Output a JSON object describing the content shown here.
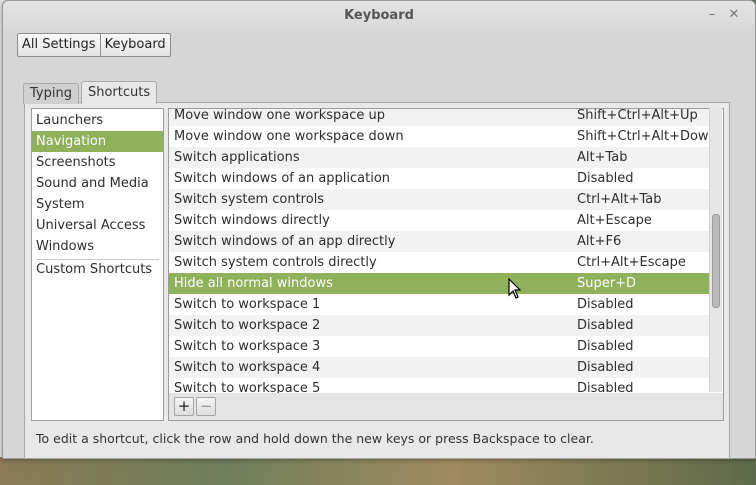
{
  "window": {
    "title": "Keyboard"
  },
  "breadcrumb": [
    "All Settings",
    "Keyboard"
  ],
  "tabs": [
    {
      "label": "Typing",
      "active": false
    },
    {
      "label": "Shortcuts",
      "active": true
    }
  ],
  "categories": {
    "items": [
      "Launchers",
      "Navigation",
      "Screenshots",
      "Sound and Media",
      "System",
      "Universal Access",
      "Windows"
    ],
    "selected": "Navigation",
    "custom": "Custom Shortcuts"
  },
  "shortcuts": [
    {
      "name": "Move window one workspace up",
      "accel": "Shift+Ctrl+Alt+Up"
    },
    {
      "name": "Move window one workspace down",
      "accel": "Shift+Ctrl+Alt+Down"
    },
    {
      "name": "Switch applications",
      "accel": "Alt+Tab"
    },
    {
      "name": "Switch windows of an application",
      "accel": "Disabled"
    },
    {
      "name": "Switch system controls",
      "accel": "Ctrl+Alt+Tab"
    },
    {
      "name": "Switch windows directly",
      "accel": "Alt+Escape"
    },
    {
      "name": "Switch windows of an app directly",
      "accel": "Alt+F6"
    },
    {
      "name": "Switch system controls directly",
      "accel": "Ctrl+Alt+Escape"
    },
    {
      "name": "Hide all normal windows",
      "accel": "Super+D",
      "selected": true
    },
    {
      "name": "Switch to workspace 1",
      "accel": "Disabled"
    },
    {
      "name": "Switch to workspace 2",
      "accel": "Disabled"
    },
    {
      "name": "Switch to workspace 3",
      "accel": "Disabled"
    },
    {
      "name": "Switch to workspace 4",
      "accel": "Disabled"
    },
    {
      "name": "Switch to workspace 5",
      "accel": "Disabled"
    }
  ],
  "toolbar": {
    "add_label": "+",
    "remove_label": "−"
  },
  "hint": "To edit a shortcut, click the row and hold down the new keys or press Backspace to clear.",
  "colors": {
    "selection": "#8fb15a"
  }
}
